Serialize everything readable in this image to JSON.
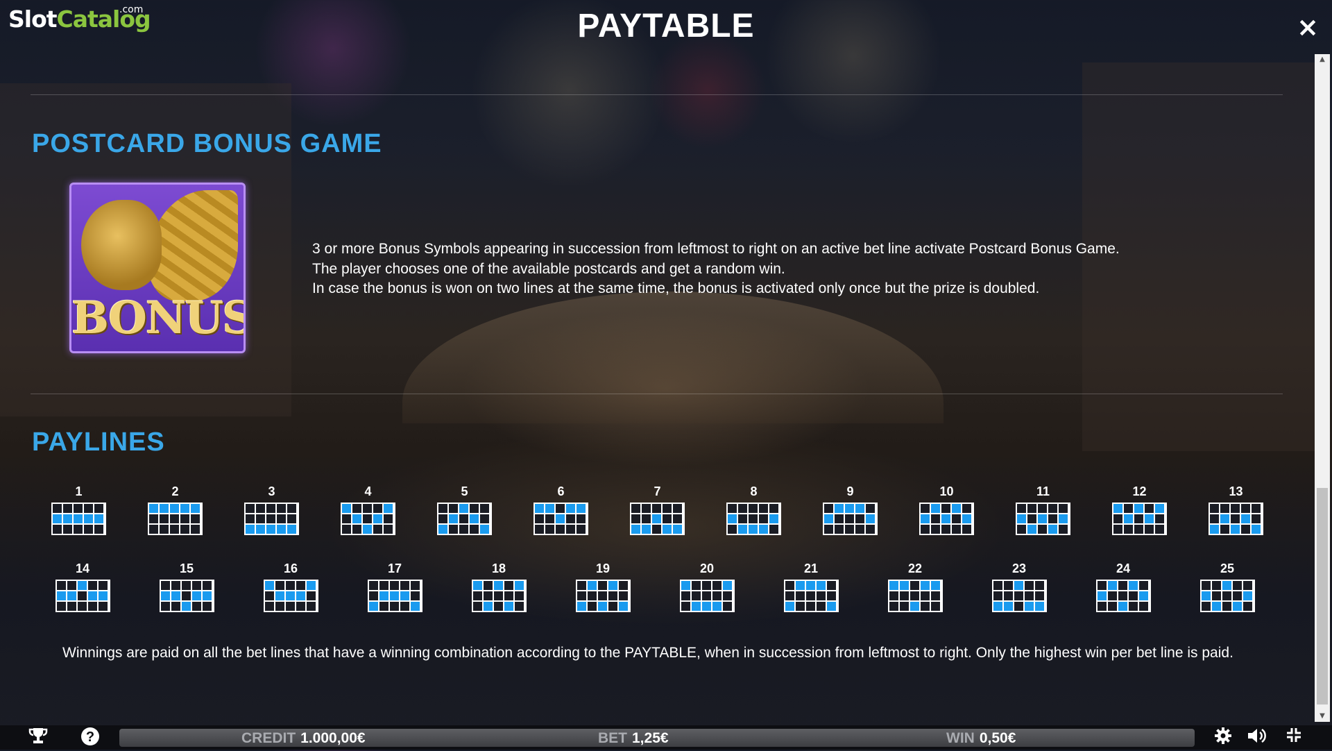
{
  "brand": {
    "logo_main": "Slot",
    "logo_accent": "Catalog",
    "logo_suffix": ".com"
  },
  "header": {
    "title": "PAYTABLE",
    "close_icon": "×"
  },
  "bonus_section": {
    "title": "POSTCARD BONUS GAME",
    "symbol_text": "BONUS",
    "description": [
      "3 or more Bonus Symbols appearing in succession from leftmost to right on an active bet line activate Postcard Bonus Game.",
      "The player chooses one of the available postcards and get a random win.",
      "In case the bonus is won on two lines at the same time, the bonus is activated only once but the prize is doubled."
    ]
  },
  "paylines_section": {
    "title": "PAYLINES",
    "highlight_color": "#1a9bef",
    "lines": [
      {
        "number": "1",
        "pattern": [
          1,
          1,
          1,
          1,
          1
        ]
      },
      {
        "number": "2",
        "pattern": [
          0,
          0,
          0,
          0,
          0
        ]
      },
      {
        "number": "3",
        "pattern": [
          2,
          2,
          2,
          2,
          2
        ]
      },
      {
        "number": "4",
        "pattern": [
          0,
          1,
          2,
          1,
          0
        ]
      },
      {
        "number": "5",
        "pattern": [
          2,
          1,
          0,
          1,
          2
        ]
      },
      {
        "number": "6",
        "pattern": [
          0,
          0,
          1,
          0,
          0
        ]
      },
      {
        "number": "7",
        "pattern": [
          2,
          2,
          1,
          2,
          2
        ]
      },
      {
        "number": "8",
        "pattern": [
          1,
          2,
          2,
          2,
          1
        ]
      },
      {
        "number": "9",
        "pattern": [
          1,
          0,
          0,
          0,
          1
        ]
      },
      {
        "number": "10",
        "pattern": [
          1,
          0,
          1,
          0,
          1
        ]
      },
      {
        "number": "11",
        "pattern": [
          1,
          2,
          1,
          2,
          1
        ]
      },
      {
        "number": "12",
        "pattern": [
          0,
          1,
          0,
          1,
          0
        ]
      },
      {
        "number": "13",
        "pattern": [
          2,
          1,
          2,
          1,
          2
        ]
      },
      {
        "number": "14",
        "pattern": [
          1,
          1,
          0,
          1,
          1
        ]
      },
      {
        "number": "15",
        "pattern": [
          1,
          1,
          2,
          1,
          1
        ]
      },
      {
        "number": "16",
        "pattern": [
          0,
          1,
          1,
          1,
          0
        ]
      },
      {
        "number": "17",
        "pattern": [
          2,
          1,
          1,
          1,
          2
        ]
      },
      {
        "number": "18",
        "pattern": [
          0,
          2,
          0,
          2,
          0
        ]
      },
      {
        "number": "19",
        "pattern": [
          2,
          0,
          2,
          0,
          2
        ]
      },
      {
        "number": "20",
        "pattern": [
          0,
          2,
          2,
          2,
          0
        ]
      },
      {
        "number": "21",
        "pattern": [
          2,
          0,
          0,
          0,
          2
        ]
      },
      {
        "number": "22",
        "pattern": [
          0,
          0,
          2,
          0,
          0
        ]
      },
      {
        "number": "23",
        "pattern": [
          2,
          2,
          0,
          2,
          2
        ]
      },
      {
        "number": "24",
        "pattern": [
          1,
          0,
          2,
          0,
          1
        ]
      },
      {
        "number": "25",
        "pattern": [
          1,
          2,
          0,
          2,
          1
        ]
      }
    ],
    "footnote": "Winnings are paid on all the bet lines that have a winning combination according to the PAYTABLE, when in succession from leftmost to right. Only the highest win per bet line is paid."
  },
  "bottom_bar": {
    "credit_label": "CREDIT",
    "credit_value": "1.000,00€",
    "bet_label": "BET",
    "bet_value": "1,25€",
    "win_label": "WIN",
    "win_value": "0,50€",
    "icons": [
      "trophy-icon",
      "help-icon",
      "settings-icon",
      "sound-icon",
      "fullscreen-icon"
    ]
  }
}
